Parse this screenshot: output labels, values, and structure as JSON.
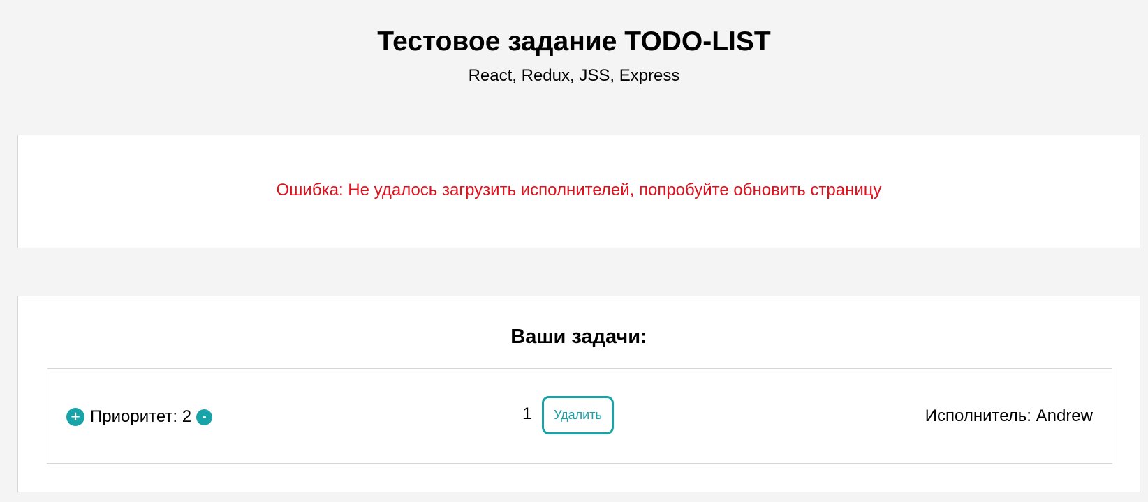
{
  "header": {
    "title": "Тестовое задание TODO-LIST",
    "subtitle": "React, Redux, JSS, Express"
  },
  "error": {
    "message": "Ошибка: Не удалось загрузить исполнителей, попробуйте обновить страницу"
  },
  "tasks": {
    "title": "Ваши задачи:",
    "items": [
      {
        "increase_label": "+",
        "priority_label": "Приоритет: 2",
        "decrease_label": "-",
        "number": "1",
        "delete_label": "Удалить",
        "assignee_label": "Исполнитель: Andrew"
      }
    ]
  },
  "colors": {
    "background": "#f4f4f4",
    "accent": "#17a3a7",
    "error": "#e0101c"
  },
  "icons": {
    "increase": "plus-icon",
    "decrease": "minus-icon"
  }
}
